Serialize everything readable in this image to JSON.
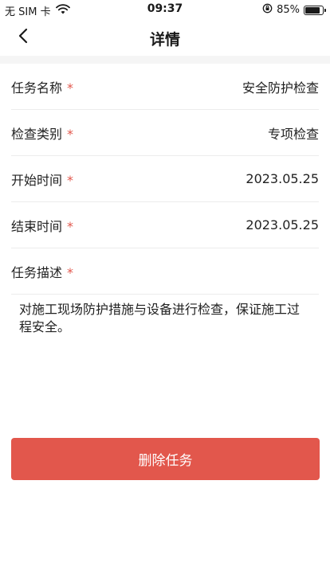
{
  "status_bar": {
    "carrier": "无 SIM 卡",
    "time": "09:37",
    "battery_percent": "85%",
    "battery_level": 0.85,
    "icons": [
      "wifi-icon",
      "moon-icon",
      "rotation-lock-icon",
      "battery-icon"
    ]
  },
  "nav": {
    "title": "详情",
    "back_icon": "chevron-left-icon"
  },
  "form": {
    "task_name": {
      "label": "任务名称",
      "required_mark": "*",
      "value": "安全防护检查"
    },
    "check_type": {
      "label": "检查类别",
      "required_mark": "*",
      "value": "专项检查"
    },
    "start_time": {
      "label": "开始时间",
      "required_mark": "*",
      "value": "2023.05.25"
    },
    "end_time": {
      "label": "结束时间",
      "required_mark": "*",
      "value": "2023.05.25"
    },
    "description": {
      "label": "任务描述",
      "required_mark": "*",
      "value": "对施工现场防护措施与设备进行检查，保证施工过程安全。"
    }
  },
  "actions": {
    "delete_label": "删除任务"
  },
  "colors": {
    "accent_red": "#e2574c",
    "divider": "#ececec",
    "strip_bg": "#f5f5f5"
  }
}
